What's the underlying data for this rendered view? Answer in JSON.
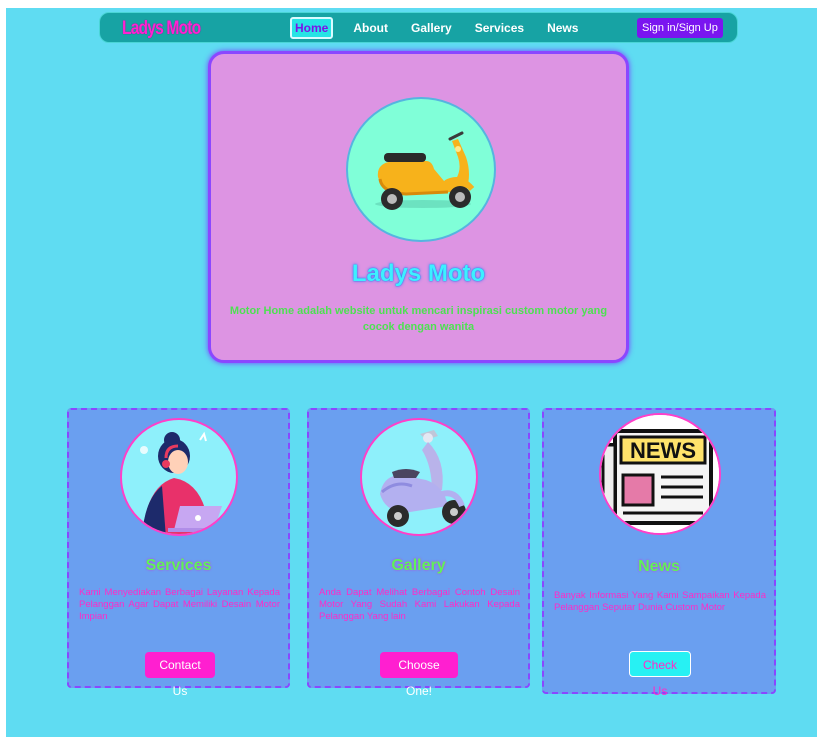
{
  "navbar": {
    "brand": "Ladys Moto",
    "links": [
      {
        "label": "Home",
        "active": true
      },
      {
        "label": "About",
        "active": false
      },
      {
        "label": "Gallery",
        "active": false
      },
      {
        "label": "Services",
        "active": false
      },
      {
        "label": "News",
        "active": false
      }
    ],
    "signin_label": "Sign in/Sign Up"
  },
  "hero": {
    "title": "Ladys Moto",
    "description": "Motor Home adalah website untuk mencari inspirasi custom motor yang cocok dengan wanita",
    "image_icon": "scooter-illustration"
  },
  "cards": [
    {
      "title": "Services",
      "text": "Kami Menyediakan Berbagai Layanan Kepada Pelanggan Agar Dapat Memiliki Desain Motor Impian",
      "button": "Contact Us",
      "image_icon": "customer-service-illustration"
    },
    {
      "title": "Gallery",
      "text": "Anda Dapat Melihat Berbagai Contoh Desain Motor Yang Sudah Kami Lakukan Kepada Pelanggan Yang lain",
      "button": "Choose One!",
      "image_icon": "vespa-illustration"
    },
    {
      "title": "News",
      "text": "Banyak Informasi Yang Kami Sampaikan Kepada Pelanggan Seputar Dunia Custom Motor",
      "button": "Check Us",
      "image_icon": "newspaper-icon"
    }
  ],
  "colors": {
    "page_bg": "#5fdcf2",
    "navbar_bg": "#17a3a4",
    "brand": "#ff22d2",
    "hero_bg": "#dd94e3",
    "card_bg": "#6a9ff0",
    "accent_purple": "#8a47ff",
    "button_magenta": "#ff1fd0",
    "button_cyan": "#27f1f3"
  }
}
